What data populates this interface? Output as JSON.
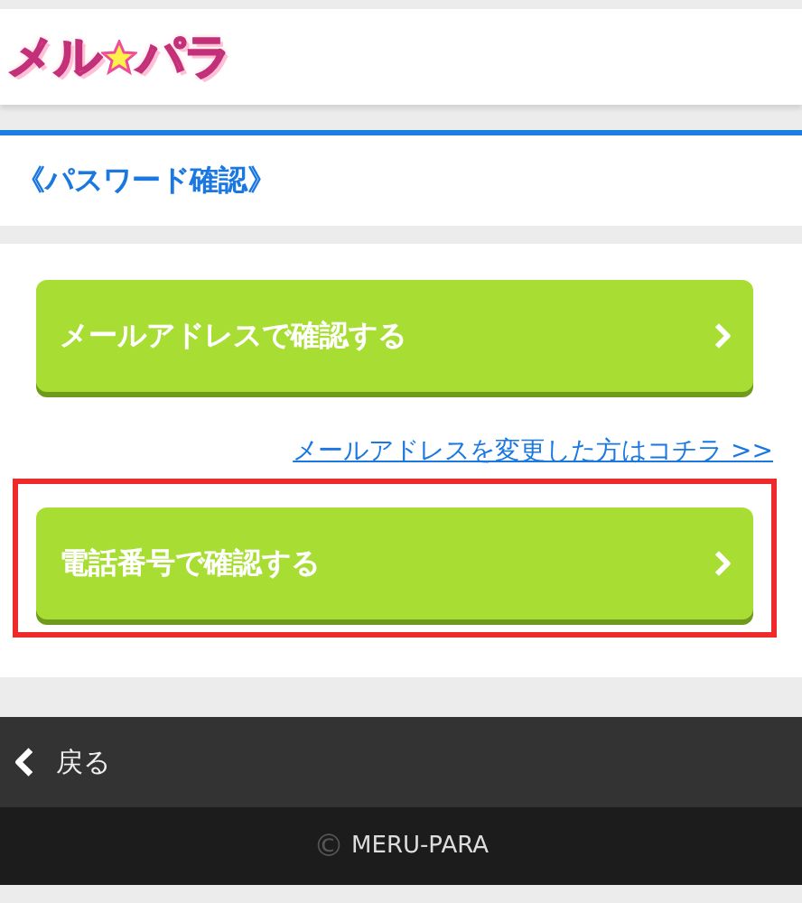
{
  "logo": {
    "left": "メル",
    "right": "パラ"
  },
  "page_title": "《パスワード確認》",
  "options": [
    {
      "label": "メールアドレスで確認する",
      "highlighted": false
    },
    {
      "link": "メールアドレスを変更した方はコチラ >>"
    },
    {
      "label": "電話番号で確認する",
      "highlighted": true
    }
  ],
  "back": {
    "label": "戻る"
  },
  "footer": {
    "copyright_mark": "©",
    "text": "MERU-PARA"
  }
}
